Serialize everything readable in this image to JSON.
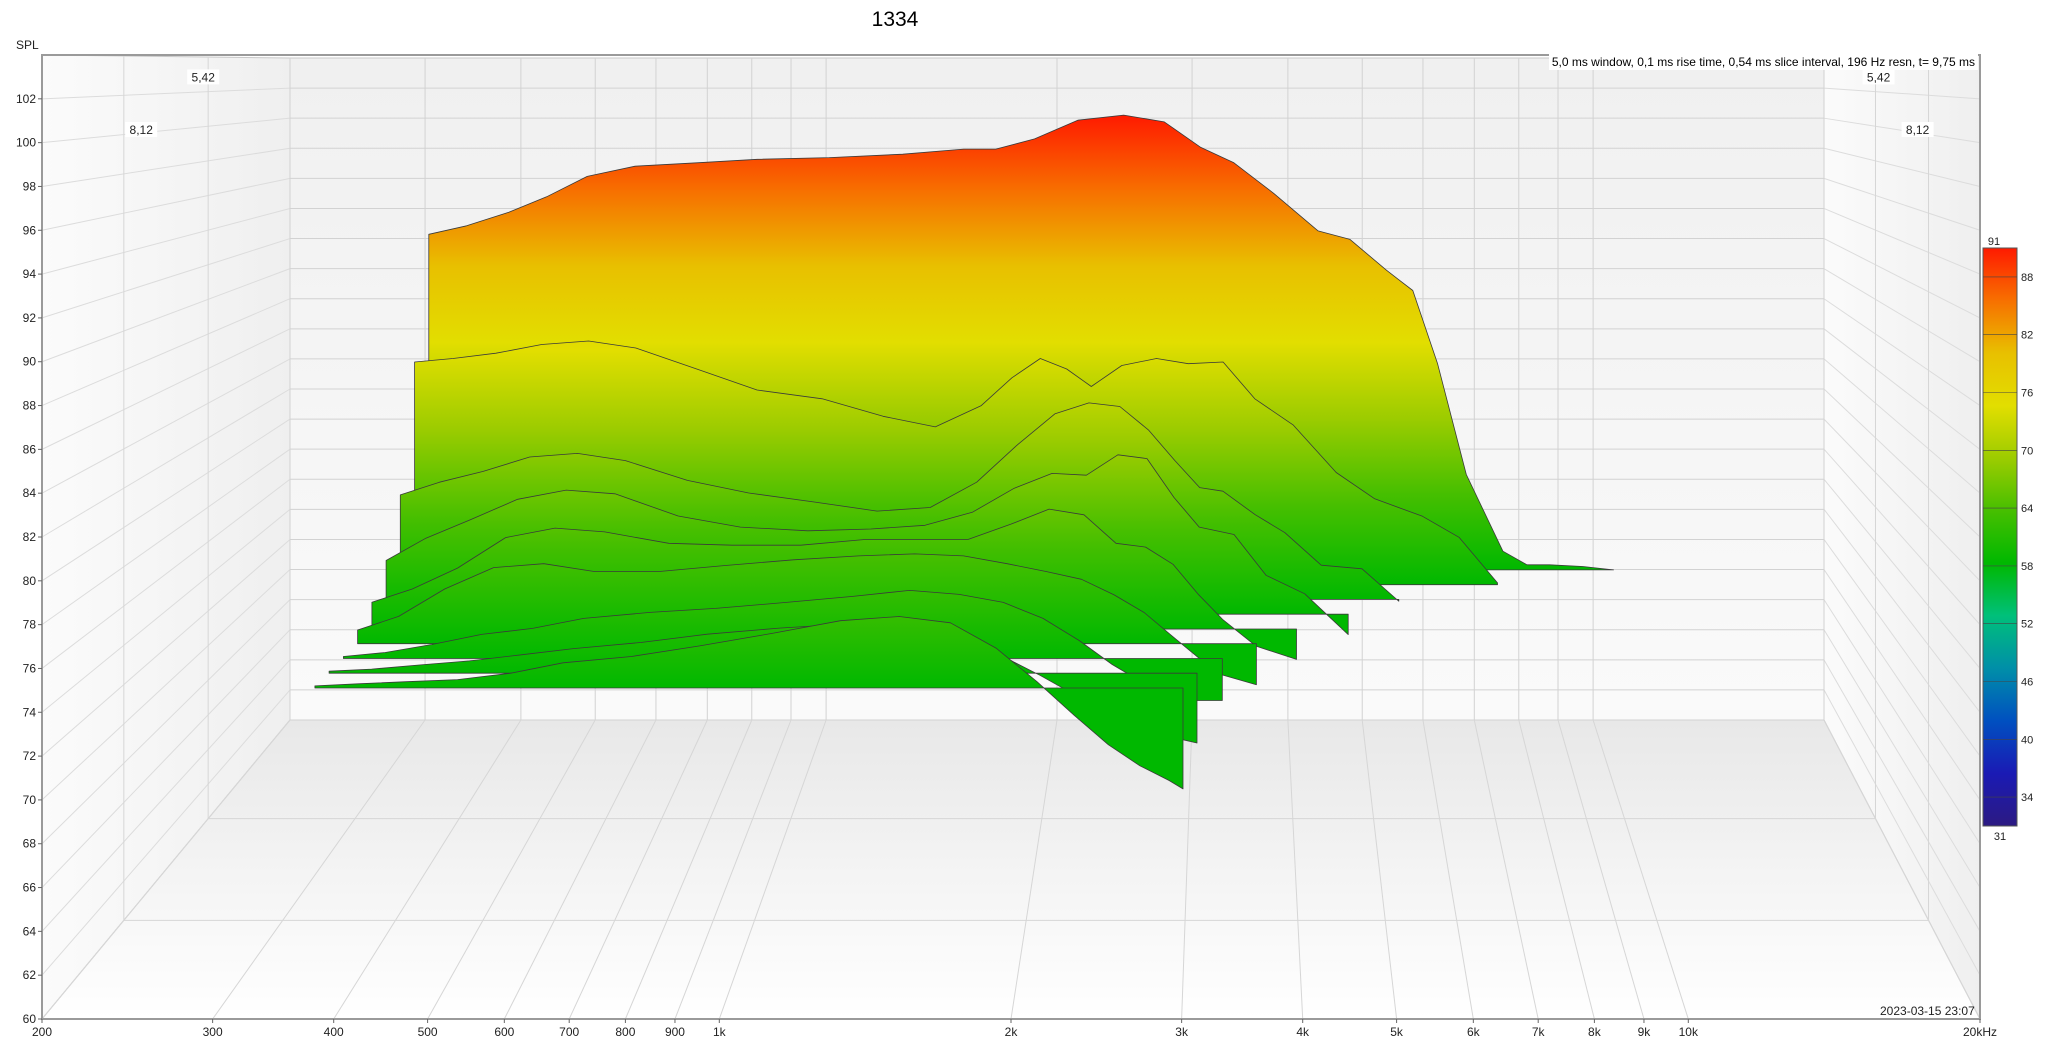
{
  "chart_data": {
    "type": "area",
    "title": "1334",
    "subtitle": "5,0 ms window, 0,1 ms rise time, 0,54 ms slice interval, 196 Hz resn, t= 9,75 ms",
    "ylabel": "SPL",
    "xlabel": "",
    "x_unit_label": "20kHz",
    "timestamp": "2023-03-15 23:07",
    "x_scale": "log",
    "xlim": [
      200,
      20000
    ],
    "ylim": [
      60,
      104
    ],
    "x_ticks": [
      {
        "v": 200,
        "label": "200"
      },
      {
        "v": 300,
        "label": "300"
      },
      {
        "v": 400,
        "label": "400"
      },
      {
        "v": 500,
        "label": "500"
      },
      {
        "v": 600,
        "label": "600"
      },
      {
        "v": 700,
        "label": "700"
      },
      {
        "v": 800,
        "label": "800"
      },
      {
        "v": 900,
        "label": "900"
      },
      {
        "v": 1000,
        "label": "1k"
      },
      {
        "v": 2000,
        "label": "2k"
      },
      {
        "v": 3000,
        "label": "3k"
      },
      {
        "v": 4000,
        "label": "4k"
      },
      {
        "v": 5000,
        "label": "5k"
      },
      {
        "v": 6000,
        "label": "6k"
      },
      {
        "v": 7000,
        "label": "7k"
      },
      {
        "v": 8000,
        "label": "8k"
      },
      {
        "v": 9000,
        "label": "9k"
      },
      {
        "v": 10000,
        "label": "10k"
      },
      {
        "v": 20000,
        "label": "20kHz"
      }
    ],
    "y_ticks": [
      60,
      62,
      64,
      66,
      68,
      70,
      72,
      74,
      76,
      78,
      80,
      82,
      84,
      86,
      88,
      90,
      92,
      94,
      96,
      98,
      100,
      102
    ],
    "time_labels": [
      "5,42",
      "8,12"
    ],
    "grid": true,
    "colorbar": {
      "max_label": "91",
      "min_label": "31",
      "ticks": [
        "88",
        "82",
        "76",
        "70",
        "64",
        "58",
        "52",
        "46",
        "40",
        "34"
      ],
      "stops": [
        "#ff1a00",
        "#f77000",
        "#e8c000",
        "#e2de00",
        "#9ccc00",
        "#46bf00",
        "#00b800",
        "#00c07a",
        "#008fa8",
        "#0050c0",
        "#1a1ab4",
        "#2c1a82"
      ]
    },
    "series": [
      {
        "x": [
          360,
          400,
          450,
          500,
          560,
          640,
          760,
          900,
          1100,
          1350,
          1600,
          1750,
          1950,
          2200,
          2500,
          2800,
          3100,
          3400,
          3800,
          4300,
          4700,
          5200,
          5600,
          6000,
          6500,
          7200,
          7700,
          8200,
          9000,
          9800
        ],
        "values": [
          93.6,
          94.1,
          94.9,
          95.8,
          97.0,
          97.6,
          97.8,
          98.0,
          98.1,
          98.3,
          98.6,
          98.6,
          99.2,
          100.3,
          100.6,
          100.2,
          98.7,
          97.8,
          96.0,
          93.8,
          93.3,
          91.5,
          90.3,
          86.0,
          79.5,
          75.0,
          74.2,
          74.2,
          74.1,
          73.9
        ]
      },
      {
        "x": [
          360,
          400,
          450,
          510,
          580,
          660,
          780,
          920,
          1100,
          1300,
          1500,
          1700,
          1850,
          2000,
          2150,
          2300,
          2500,
          2750,
          3000,
          3300,
          3600,
          4000,
          4500,
          5000,
          5700,
          6300,
          7000
        ],
        "values": [
          86.6,
          86.8,
          87.1,
          87.6,
          87.8,
          87.4,
          86.2,
          85.0,
          84.5,
          83.5,
          82.9,
          84.1,
          85.7,
          86.8,
          86.2,
          85.2,
          86.4,
          86.8,
          86.5,
          86.6,
          84.5,
          83.0,
          80.3,
          78.8,
          77.8,
          76.6,
          74.0
        ]
      },
      {
        "x": [
          360,
          400,
          450,
          510,
          580,
          660,
          780,
          920,
          1100,
          1300,
          1500,
          1700,
          1900,
          2100,
          2300,
          2500,
          2700,
          2900,
          3100,
          3300,
          3600,
          3900,
          4300,
          4800,
          5300
        ],
        "values": [
          79.7,
          80.4,
          81.0,
          81.8,
          82.0,
          81.6,
          80.5,
          79.8,
          79.3,
          78.8,
          79.0,
          80.4,
          82.5,
          84.2,
          84.8,
          84.6,
          83.3,
          81.6,
          80.1,
          79.9,
          78.6,
          77.6,
          75.8,
          75.6,
          73.8
        ]
      },
      {
        "x": [
          360,
          400,
          450,
          510,
          580,
          660,
          780,
          920,
          1100,
          1300,
          1500,
          1700,
          1900,
          2100,
          2300,
          2500,
          2700,
          2900,
          3100,
          3400,
          3700,
          4100,
          4600
        ],
        "values": [
          76.8,
          78.0,
          79.0,
          80.1,
          80.6,
          80.4,
          79.2,
          78.6,
          78.4,
          78.5,
          78.7,
          79.4,
          80.7,
          81.5,
          81.4,
          82.5,
          82.3,
          80.2,
          78.6,
          78.2,
          76.0,
          75.0,
          72.8
        ]
      },
      {
        "x": [
          360,
          400,
          450,
          510,
          580,
          660,
          780,
          920,
          1100,
          1300,
          1500,
          1700,
          1900,
          2100,
          2300,
          2500,
          2700,
          2900,
          3100,
          3300,
          3600,
          4000
        ],
        "values": [
          75.3,
          76.0,
          77.1,
          78.7,
          79.2,
          79.0,
          78.4,
          78.3,
          78.3,
          78.6,
          78.6,
          78.6,
          79.4,
          80.2,
          79.9,
          78.4,
          78.2,
          77.3,
          75.7,
          74.4,
          73.0,
          72.3
        ]
      },
      {
        "x": [
          360,
          400,
          450,
          510,
          580,
          660,
          780,
          920,
          1100,
          1300,
          1500,
          1700,
          1900,
          2100,
          2300,
          2500,
          2700,
          2900,
          3100,
          3300,
          3600
        ],
        "values": [
          74.6,
          75.3,
          76.7,
          77.8,
          78.0,
          77.6,
          77.6,
          77.9,
          78.2,
          78.4,
          78.5,
          78.4,
          78.0,
          77.6,
          77.2,
          76.4,
          75.5,
          74.3,
          73.2,
          72.3,
          71.8
        ]
      },
      {
        "x": [
          360,
          400,
          450,
          510,
          580,
          660,
          780,
          920,
          1100,
          1300,
          1500,
          1700,
          1900,
          2100,
          2300,
          2500,
          2700,
          2900,
          3100,
          3300
        ],
        "values": [
          74.0,
          74.2,
          74.6,
          75.1,
          75.4,
          75.9,
          76.2,
          76.4,
          76.7,
          77.0,
          77.3,
          77.1,
          76.7,
          75.9,
          74.8,
          73.6,
          72.7,
          72.0,
          71.8,
          71.8
        ]
      },
      {
        "x": [
          360,
          400,
          450,
          510,
          580,
          660,
          780,
          920,
          1100,
          1300,
          1500,
          1700,
          1900,
          2100,
          2300,
          2500,
          2700,
          2900,
          3100
        ],
        "values": [
          74.0,
          74.1,
          74.3,
          74.5,
          74.8,
          75.1,
          75.4,
          75.8,
          76.1,
          76.3,
          76.1,
          75.6,
          74.8,
          73.8,
          72.8,
          71.9,
          71.2,
          70.8,
          70.5
        ]
      },
      {
        "x": [
          360,
          400,
          450,
          510,
          580,
          660,
          780,
          920,
          1100,
          1300,
          1500,
          1700,
          1900,
          2100,
          2300,
          2500,
          2700,
          2900,
          3000
        ],
        "values": [
          74.0,
          74.1,
          74.2,
          74.3,
          74.6,
          75.1,
          75.4,
          75.9,
          76.5,
          77.1,
          77.3,
          77.0,
          75.8,
          74.2,
          72.6,
          71.2,
          70.2,
          69.5,
          69.1
        ]
      }
    ]
  }
}
